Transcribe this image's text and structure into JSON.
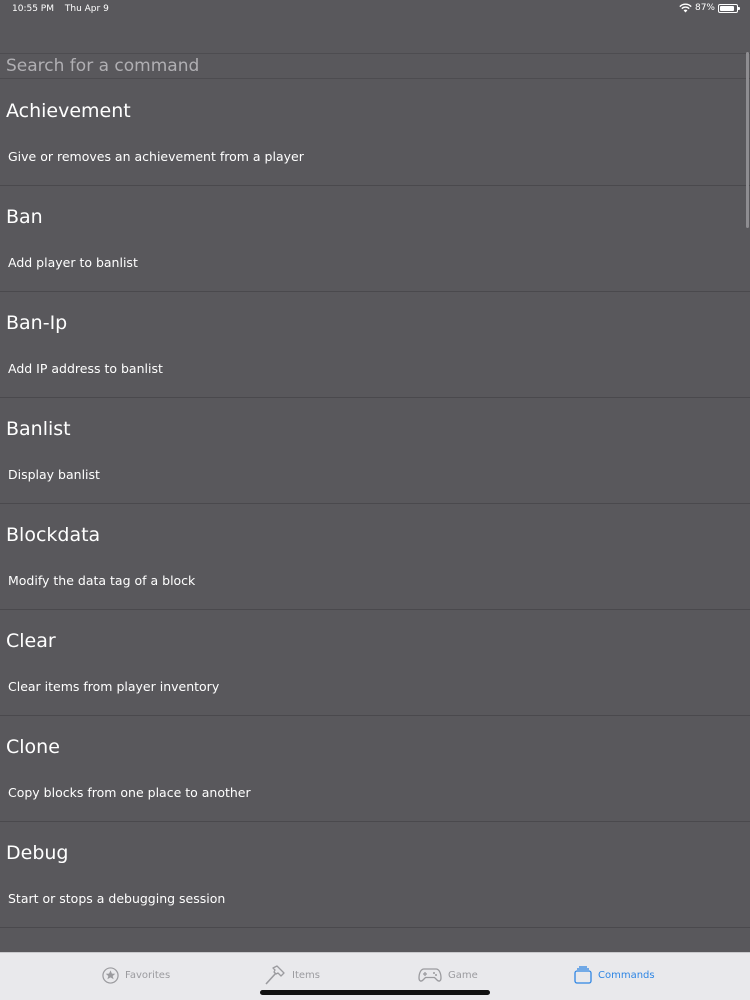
{
  "status_bar": {
    "time": "10:55 PM",
    "date": "Thu Apr 9",
    "battery_label": "87%",
    "battery_level": 0.87,
    "wifi_icon": "wifi-icon",
    "battery_icon": "battery-icon"
  },
  "search": {
    "placeholder": "Search for a command",
    "value": ""
  },
  "commands": [
    {
      "title": "Achievement",
      "description": "Give or removes an achievement from a player"
    },
    {
      "title": "Ban",
      "description": "Add player to banlist"
    },
    {
      "title": "Ban-Ip",
      "description": "Add IP address to banlist"
    },
    {
      "title": "Banlist",
      "description": "Display banlist"
    },
    {
      "title": "Blockdata",
      "description": "Modify the data tag of a block"
    },
    {
      "title": "Clear",
      "description": "Clear items from player inventory"
    },
    {
      "title": "Clone",
      "description": "Copy blocks from one place to another"
    },
    {
      "title": "Debug",
      "description": "Start or stops a debugging session"
    }
  ],
  "tab_bar": {
    "tabs": [
      {
        "label": "Favorites",
        "icon": "star-icon",
        "active": false
      },
      {
        "label": "Items",
        "icon": "hammer-icon",
        "active": false
      },
      {
        "label": "Game",
        "icon": "gamepad-icon",
        "active": false
      },
      {
        "label": "Commands",
        "icon": "commands-icon",
        "active": true
      }
    ]
  },
  "colors": {
    "background": "#59585c",
    "tab_bar_background": "#e9e9ec",
    "active_tab": "#2f86e4",
    "inactive_tab": "#9b9b9f"
  }
}
